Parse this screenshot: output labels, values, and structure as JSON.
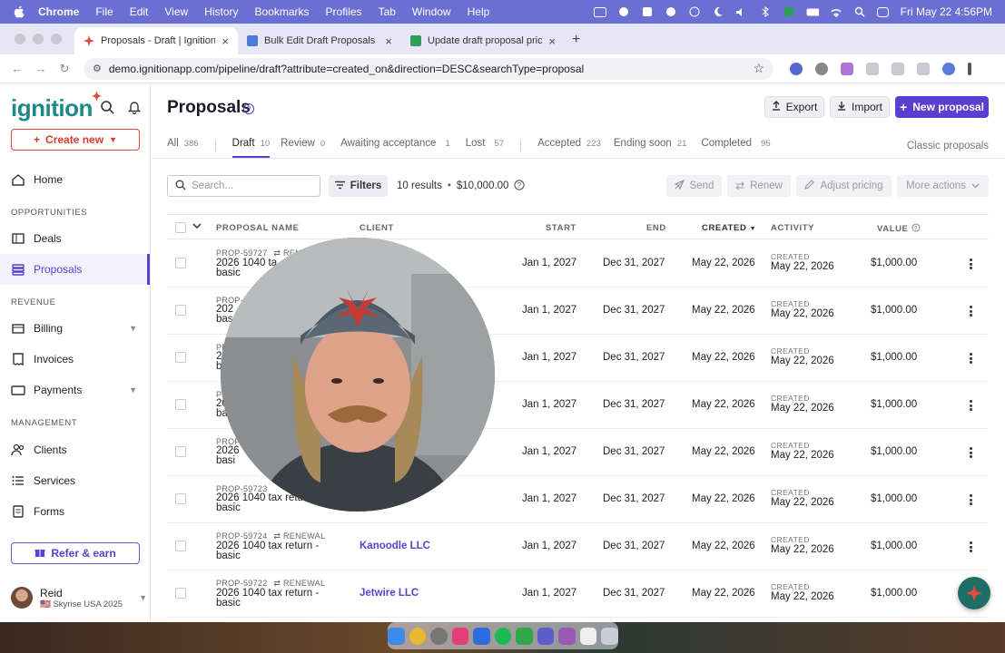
{
  "menubar": {
    "app": "Chrome",
    "items": [
      "File",
      "Edit",
      "View",
      "History",
      "Bookmarks",
      "Profiles",
      "Tab",
      "Window",
      "Help"
    ],
    "datetime": "Fri May 22  4:56PM"
  },
  "browser": {
    "tabs": [
      {
        "title": "Proposals - Draft | Ignition",
        "favicon_color": "#e8493c"
      },
      {
        "title": "Bulk Edit Draft Proposals - Pr",
        "favicon_color": "#4a7bd8"
      },
      {
        "title": "Update draft proposal pricing",
        "favicon_color": "#2e9e5a"
      }
    ],
    "url": "demo.ignitionapp.com/pipeline/draft?attribute=created_on&direction=DESC&searchType=proposal"
  },
  "sidebar": {
    "logo": "ignition",
    "create_new": "Create new",
    "home": "Home",
    "section_opportunities": "OPPORTUNITIES",
    "deals": "Deals",
    "proposals": "Proposals",
    "section_revenue": "REVENUE",
    "billing": "Billing",
    "invoices": "Invoices",
    "payments": "Payments",
    "section_management": "MANAGEMENT",
    "clients": "Clients",
    "services": "Services",
    "forms": "Forms",
    "refer": "Refer & earn",
    "user_name": "Reid",
    "user_org": "🇺🇸 Skyrise USA 2025"
  },
  "header": {
    "title": "Proposals",
    "export": "Export",
    "import": "Import",
    "new_proposal": "New proposal"
  },
  "tabs": {
    "all": {
      "label": "All",
      "count": "386"
    },
    "draft": {
      "label": "Draft",
      "count": "10"
    },
    "review": {
      "label": "Review",
      "count": "0"
    },
    "awaiting": {
      "label": "Awaiting acceptance",
      "count": "1"
    },
    "lost": {
      "label": "Lost",
      "count": "57"
    },
    "accepted": {
      "label": "Accepted",
      "count": "223"
    },
    "ending": {
      "label": "Ending soon",
      "count": "21"
    },
    "completed": {
      "label": "Completed",
      "count": "95"
    },
    "classic": "Classic proposals"
  },
  "toolbar": {
    "search_placeholder": "Search...",
    "filters": "Filters",
    "results": "10 results",
    "total": "$10,000.00",
    "send": "Send",
    "renew": "Renew",
    "adjust": "Adjust pricing",
    "more": "More actions"
  },
  "table": {
    "headers": {
      "name": "PROPOSAL NAME",
      "client": "CLIENT",
      "start": "START",
      "end": "END",
      "created": "CREATED",
      "activity": "ACTIVITY",
      "value": "VALUE"
    },
    "rows": [
      {
        "id": "PROP-59727",
        "renewal": "RENEWAL",
        "name1": "2026 1040 ta",
        "name2": "basic",
        "client": "",
        "start": "Jan 1, 2027",
        "end": "Dec 31, 2027",
        "created": "May 22, 2026",
        "activity_label": "CREATED",
        "activity_date": "May 22, 2026",
        "value": "$1,000.00"
      },
      {
        "id": "PROP-5",
        "renewal": "",
        "name1": "202",
        "name2": "bas",
        "client": "",
        "start": "Jan 1, 2027",
        "end": "Dec 31, 2027",
        "created": "May 22, 2026",
        "activity_label": "CREATED",
        "activity_date": "May 22, 2026",
        "value": "$1,000.00"
      },
      {
        "id": "PROP-",
        "renewal": "",
        "name1": "2",
        "name2": "b",
        "client": "",
        "start": "Jan 1, 2027",
        "end": "Dec 31, 2027",
        "created": "May 22, 2026",
        "activity_label": "CREATED",
        "activity_date": "May 22, 2026",
        "value": "$1,000.00"
      },
      {
        "id": "PROP-",
        "renewal": "",
        "name1": "2026",
        "name2": "basi",
        "client": "",
        "start": "Jan 1, 2027",
        "end": "Dec 31, 2027",
        "created": "May 22, 2026",
        "activity_label": "CREATED",
        "activity_date": "May 22, 2026",
        "value": "$1,000.00"
      },
      {
        "id": "PROP-",
        "renewal": "",
        "name1": "2026",
        "name2": "basi",
        "client": "",
        "start": "Jan 1, 2027",
        "end": "Dec 31, 2027",
        "created": "May 22, 2026",
        "activity_label": "CREATED",
        "activity_date": "May 22, 2026",
        "value": "$1,000.00"
      },
      {
        "id": "PROP-59723",
        "renewal": "",
        "name1": "2026 1040 tax return",
        "name2": "basic",
        "client": "",
        "start": "Jan 1, 2027",
        "end": "Dec 31, 2027",
        "created": "May 22, 2026",
        "activity_label": "CREATED",
        "activity_date": "May 22, 2026",
        "value": "$1,000.00"
      },
      {
        "id": "PROP-59724",
        "renewal": "RENEWAL",
        "name1": "2026 1040 tax return -",
        "name2": "basic",
        "client": "Kanoodle LLC",
        "start": "Jan 1, 2027",
        "end": "Dec 31, 2027",
        "created": "May 22, 2026",
        "activity_label": "CREATED",
        "activity_date": "May 22, 2026",
        "value": "$1,000.00"
      },
      {
        "id": "PROP-59722",
        "renewal": "RENEWAL",
        "name1": "2026 1040 tax return -",
        "name2": "basic",
        "client": "Jetwire LLC",
        "start": "Jan 1, 2027",
        "end": "Dec 31, 2027",
        "created": "May 22, 2026",
        "activity_label": "CREATED",
        "activity_date": "May 22, 2026",
        "value": "$1,000.00"
      }
    ]
  },
  "colors": {
    "accent": "#5b3fd0",
    "brand_teal": "#1c8a86",
    "brand_red": "#e8493c"
  }
}
